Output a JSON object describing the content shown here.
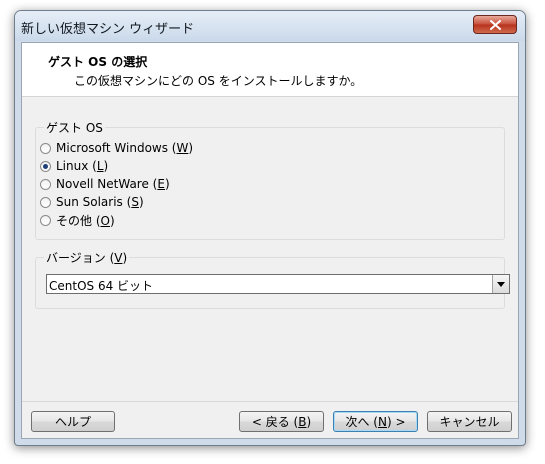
{
  "window": {
    "title": "新しい仮想マシン ウィザード"
  },
  "header": {
    "title": "ゲスト OS の選択",
    "subtitle": "この仮想マシンにどの OS をインストールしますか。"
  },
  "guest_os_group": {
    "label": "ゲスト OS",
    "options": [
      {
        "label": "Microsoft Windows (",
        "key": "W",
        "suffix": ")",
        "selected": false
      },
      {
        "label": "Linux (",
        "key": "L",
        "suffix": ")",
        "selected": true
      },
      {
        "label": "Novell NetWare (",
        "key": "E",
        "suffix": ")",
        "selected": false
      },
      {
        "label": "Sun Solaris (",
        "key": "S",
        "suffix": ")",
        "selected": false
      },
      {
        "label": "その他 (",
        "key": "O",
        "suffix": ")",
        "selected": false
      }
    ]
  },
  "version_group": {
    "label": "バージョン (",
    "key": "V",
    "suffix": ")",
    "selected_value": "CentOS 64 ビット"
  },
  "buttons": {
    "help": "ヘルプ",
    "back_prefix": "< 戻る (",
    "back_key": "B",
    "back_suffix": ")",
    "next_prefix": "次へ (",
    "next_key": "N",
    "next_suffix": ") >",
    "cancel": "キャンセル"
  },
  "colors": {
    "accent": "#3c7fb1",
    "close_red": "#c8503c"
  },
  "icons": {
    "close": "close-icon",
    "dropdown": "chevron-down-icon"
  }
}
